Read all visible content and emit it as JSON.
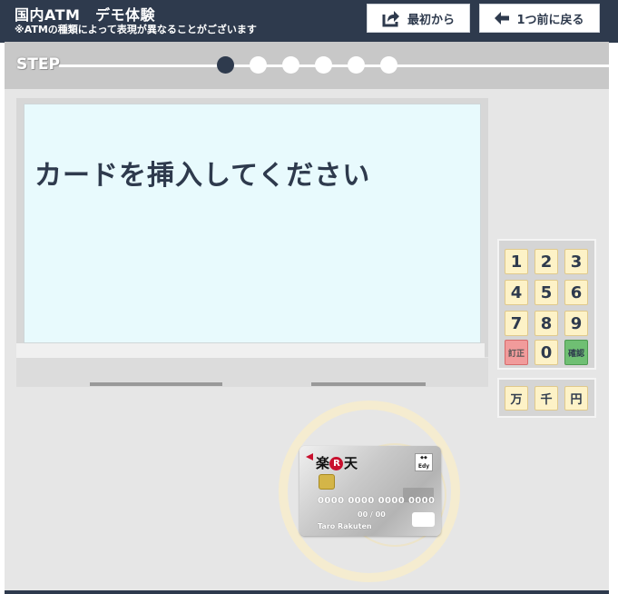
{
  "header": {
    "title": "国内ATM　デモ体験",
    "subtitle": "※ATMの種類によって表現が異なることがございます",
    "restart_label": "最初から",
    "back_label": "1つ前に戻る"
  },
  "steps": {
    "label": "STEP",
    "total": 6,
    "current": 1
  },
  "screen": {
    "message": "カードを挿入してください"
  },
  "keypad": {
    "keys": [
      "1",
      "2",
      "3",
      "4",
      "5",
      "6",
      "7",
      "8",
      "9",
      "訂正",
      "0",
      "確認"
    ],
    "units": [
      "万",
      "千",
      "円"
    ]
  },
  "card": {
    "brand": "楽R天",
    "edy_label": "Edy",
    "number": "0000 0000 0000 0000",
    "expiry": "00 / 00",
    "holder": "Taro Rakuten"
  },
  "colors": {
    "navy": "#2e3a4d",
    "screen_bg": "#e8fafd",
    "key_bg": "#fdf2c7",
    "correct_red": "#f19b9b",
    "confirm_green": "#6fbf73"
  }
}
